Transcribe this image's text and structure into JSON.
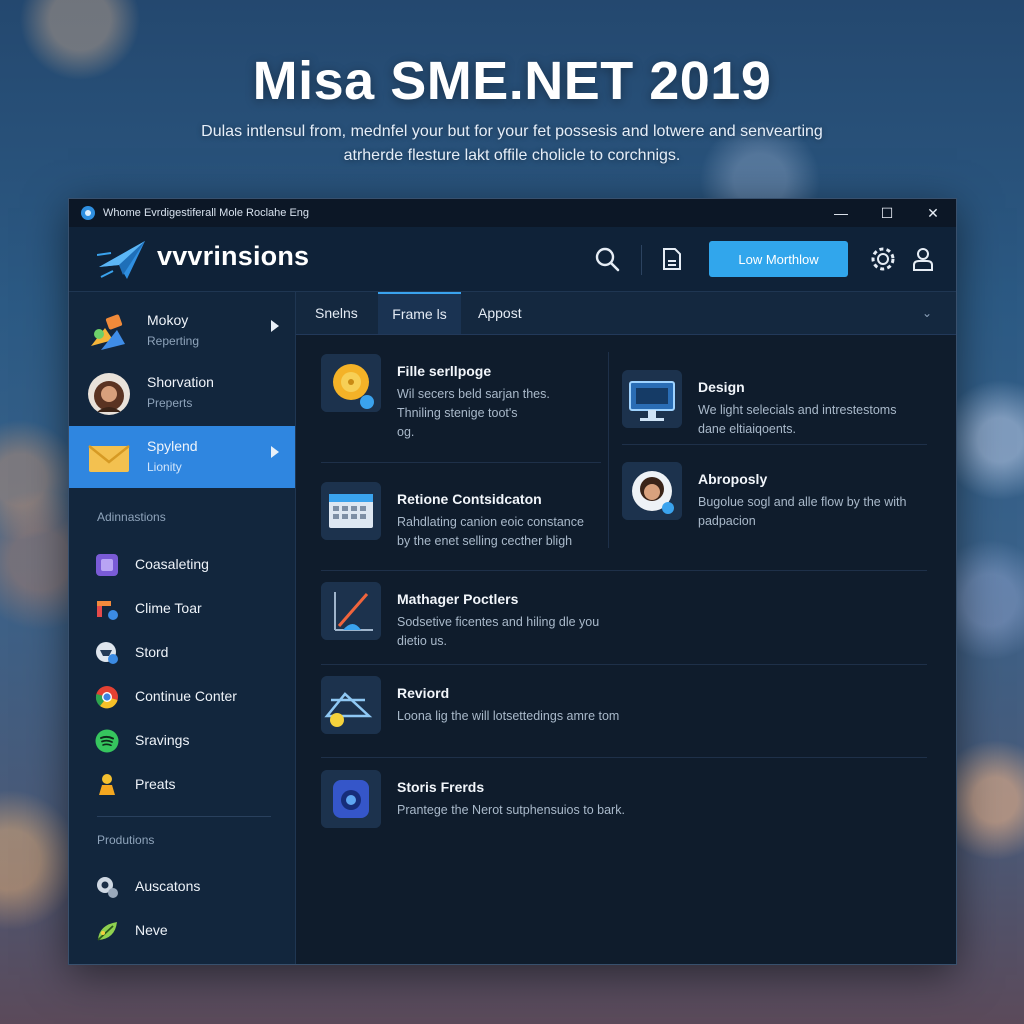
{
  "hero": {
    "title": "Misa SME.NET 2019",
    "subtitle": "Dulas intlensul from, mednfel your but for your fet possesis and lotwere and senvearting atrherde flesture lakt offile cholicle to corchnigs."
  },
  "window": {
    "title": "Whome Evrdigestiferall Mole Roclahe Eng",
    "controls": {
      "minimize": "—",
      "maximize": "☐",
      "close": "✕"
    }
  },
  "header": {
    "brand": "vvvrinsions",
    "primary_button": "Low Morthlow",
    "icons": [
      "search-icon",
      "document-icon",
      "gear-icon",
      "user-icon"
    ]
  },
  "sidebar": {
    "items": [
      {
        "title": "Mokoy",
        "subtitle": "Reperting",
        "icon": "colorful-bundle-icon"
      },
      {
        "title": "Shorvation",
        "subtitle": "Preperts",
        "icon": "avatar"
      },
      {
        "title": "Spylend",
        "subtitle": "Lionity",
        "icon": "envelope-icon",
        "active": true
      }
    ],
    "section1": "Adinnastions",
    "nav": [
      {
        "label": "Coasaleting",
        "icon": "purple-square-icon"
      },
      {
        "label": "Clime Toar",
        "icon": "tool-icon"
      },
      {
        "label": "Stord",
        "icon": "store-icon"
      },
      {
        "label": "Continue Conter",
        "icon": "chrome-icon"
      },
      {
        "label": "Sravings",
        "icon": "spotify-icon"
      },
      {
        "label": "Preats",
        "icon": "person-icon"
      }
    ],
    "section2": "Produtions",
    "nav2": [
      {
        "label": "Auscatons",
        "icon": "gears-icon"
      },
      {
        "label": "Neve",
        "icon": "leaf-icon"
      }
    ]
  },
  "tabs": [
    "Snelns",
    "Frame ls",
    "Appost"
  ],
  "cards": [
    {
      "title": "Fille serllpoge",
      "desc1": "Wil secers beld sarjan thes.",
      "desc2": "Thniling stenige toot's",
      "desc3": "og."
    },
    {
      "title": "Design",
      "desc1": "We light selecials and intrestestoms",
      "desc2": "dane eltiaiqoents."
    },
    {
      "title": "Retione Contsidcaton",
      "desc1": "Rahdlating canion eoic constance",
      "desc2": "by the enet selling cecther bligh"
    },
    {
      "title": "Abroposly",
      "desc1": "Bugolue sogl and alle flow by the with",
      "desc2": "padpacion"
    },
    {
      "title": "Mathager Poctlers",
      "desc1": "Sodsetive ficentes and hiling dle you",
      "desc2": "dietio us."
    },
    {
      "title": "Reviord",
      "desc1": "Loona lig the will lotsettedings amre tom"
    },
    {
      "title": "Storis Frerds",
      "desc1": "Prantege the Nerot sutphensuios to bark."
    }
  ],
  "colors": {
    "accent": "#31a6ec",
    "active_sidebar": "#2f86e0",
    "window_bg": "#101d2e"
  }
}
